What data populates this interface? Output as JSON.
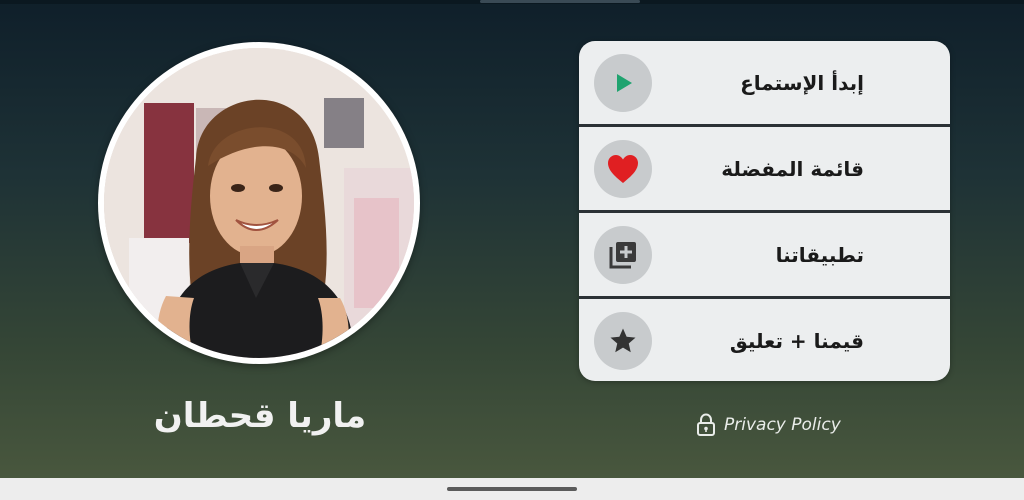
{
  "profile": {
    "name": "ماريا قحطان",
    "avatar_icon": "singer-photo"
  },
  "menu": {
    "items": [
      {
        "label": "إبدأ الإستماع",
        "icon": "play-icon",
        "icon_color": "#1fa36f"
      },
      {
        "label": "قائمة المفضلة",
        "icon": "heart-icon",
        "icon_color": "#e01f22"
      },
      {
        "label": "تطبيقاتنا",
        "icon": "add-to-collection-icon",
        "icon_color": "#3a3a3a"
      },
      {
        "label": "قيمنا + تعليق",
        "icon": "star-icon",
        "icon_color": "#333333"
      }
    ]
  },
  "privacy": {
    "label": "Privacy Policy",
    "icon": "lock-icon"
  },
  "colors": {
    "menu_background": "#eceeef",
    "icon_circle": "#c8cbcd",
    "background_top": "#0f1f2a",
    "background_bottom": "#4c5a3f"
  }
}
